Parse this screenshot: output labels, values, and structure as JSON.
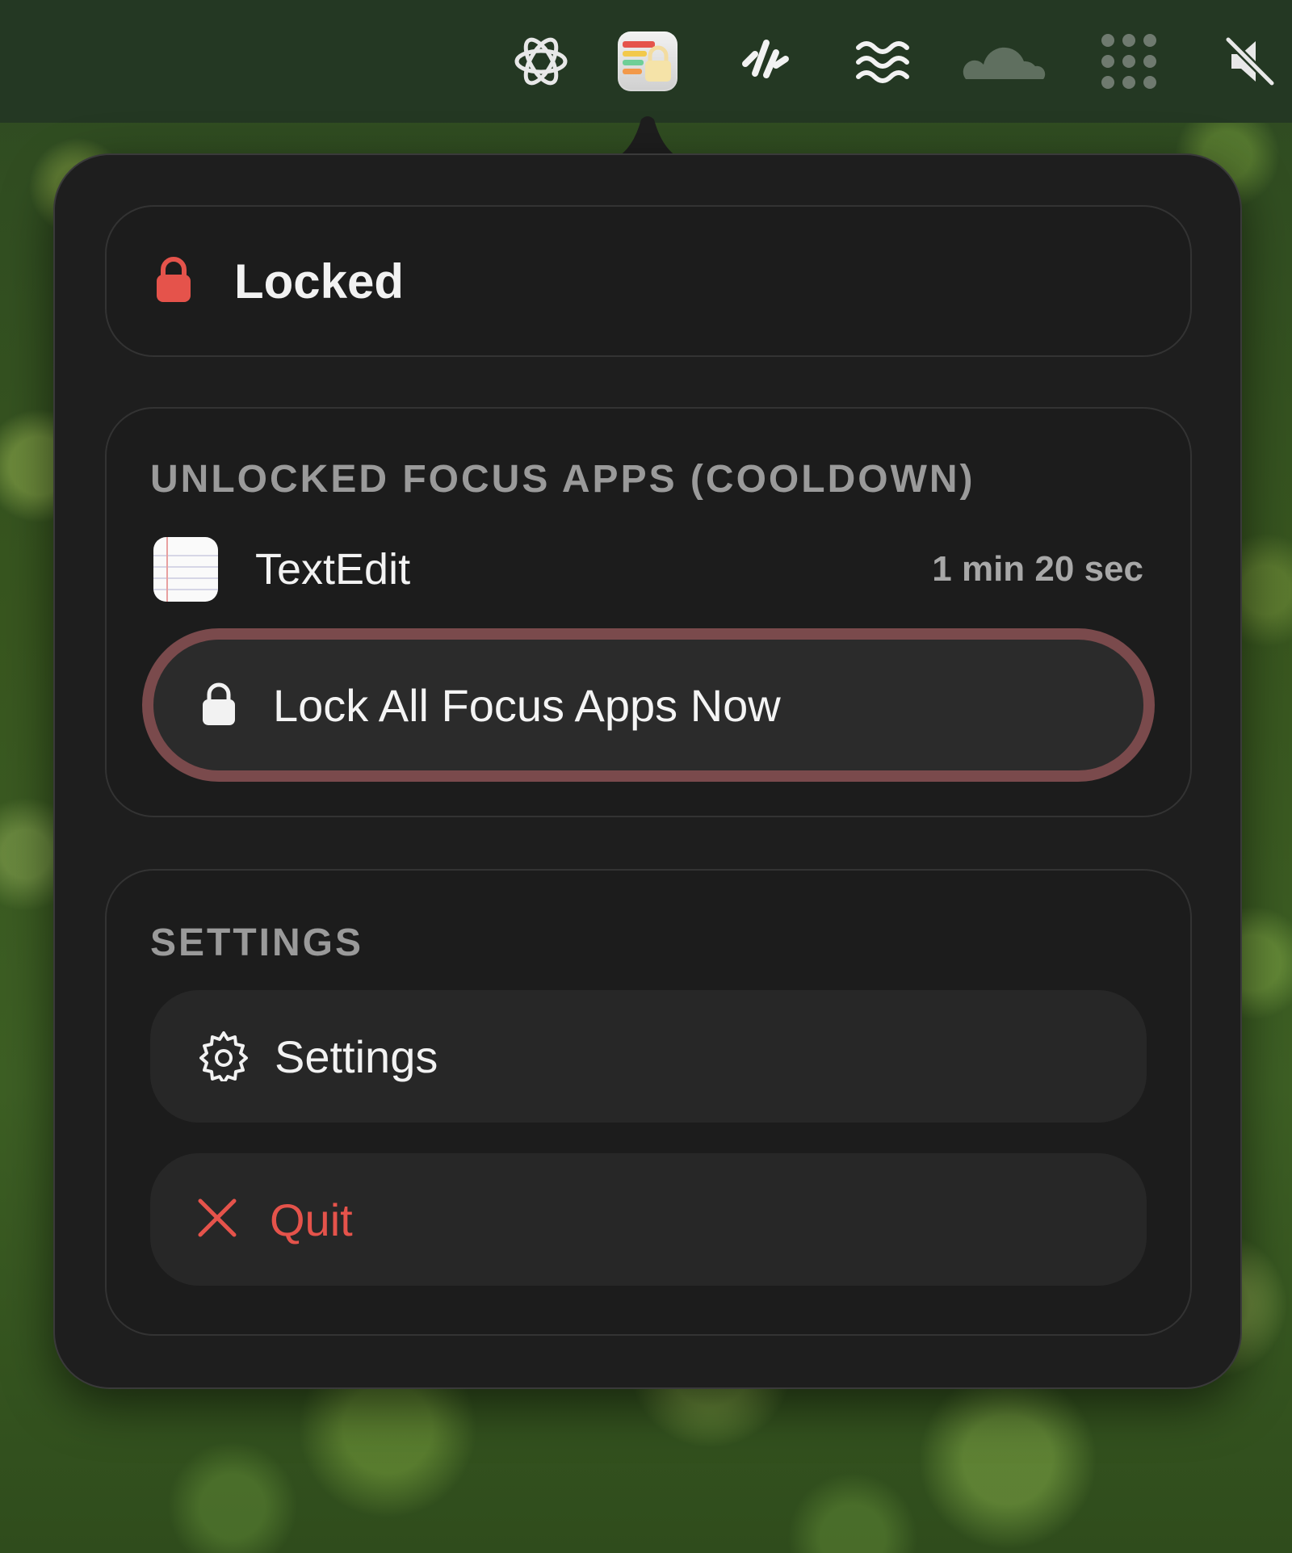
{
  "menubar": {
    "icons": [
      "openai-icon",
      "app-locker-icon",
      "waveform-icon",
      "waves-icon",
      "cloudflare-icon",
      "grid-dots-icon",
      "mute-icon"
    ]
  },
  "status": {
    "label": "Locked",
    "icon": "lock-icon",
    "icon_color": "#e5534b"
  },
  "focus_apps": {
    "header": "UNLOCKED FOCUS APPS (COOLDOWN)",
    "apps": [
      {
        "name": "TextEdit",
        "remaining": "1 min 20 sec",
        "icon": "textedit-icon"
      }
    ],
    "lock_all_label": "Lock All Focus Apps Now",
    "lock_all_border_color": "#7a4a4c"
  },
  "settings_section": {
    "header": "SETTINGS",
    "settings_label": "Settings",
    "quit_label": "Quit",
    "quit_color": "#e5534b"
  }
}
